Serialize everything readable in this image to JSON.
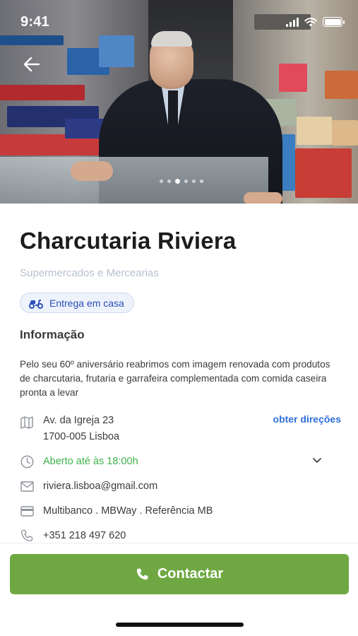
{
  "status_bar": {
    "time": "9:41"
  },
  "hero": {
    "slide_count": 6,
    "active_slide": 3
  },
  "store": {
    "name": "Charcutaria Riviera",
    "category": "Supermercados e Mercearias",
    "badge": {
      "label": "Entrega em casa",
      "icon": "scooter-icon"
    }
  },
  "info": {
    "section_title": "Informação",
    "description": "Pelo seu 60º aniversário reabrimos com imagem renovada com produtos de charcutaria, frutaria e garrafeira complementada com comida caseira pronta a levar",
    "address": {
      "line1": "Av. da Igreja 23",
      "line2": "1700-005 Lisboa",
      "icon": "map-icon"
    },
    "directions_label": "obter direções",
    "hours": {
      "text": "Aberto até às 18:00h",
      "icon": "clock-icon"
    },
    "email": {
      "text": "riviera.lisboa@gmail.com",
      "icon": "mail-icon"
    },
    "payment": {
      "text": "Multibanco . MBWay . Referência MB",
      "icon": "card-icon"
    },
    "phone": {
      "text": "+351 218 497 620",
      "icon": "phone-icon"
    }
  },
  "contact_button": {
    "label": "Contactar",
    "icon": "phone-icon"
  },
  "colors": {
    "brand_green": "#6fa842",
    "link_blue": "#2f6fd8",
    "open_green": "#41b24b",
    "badge_bg": "#eef2fb",
    "category_gray": "#b7c0cf"
  }
}
